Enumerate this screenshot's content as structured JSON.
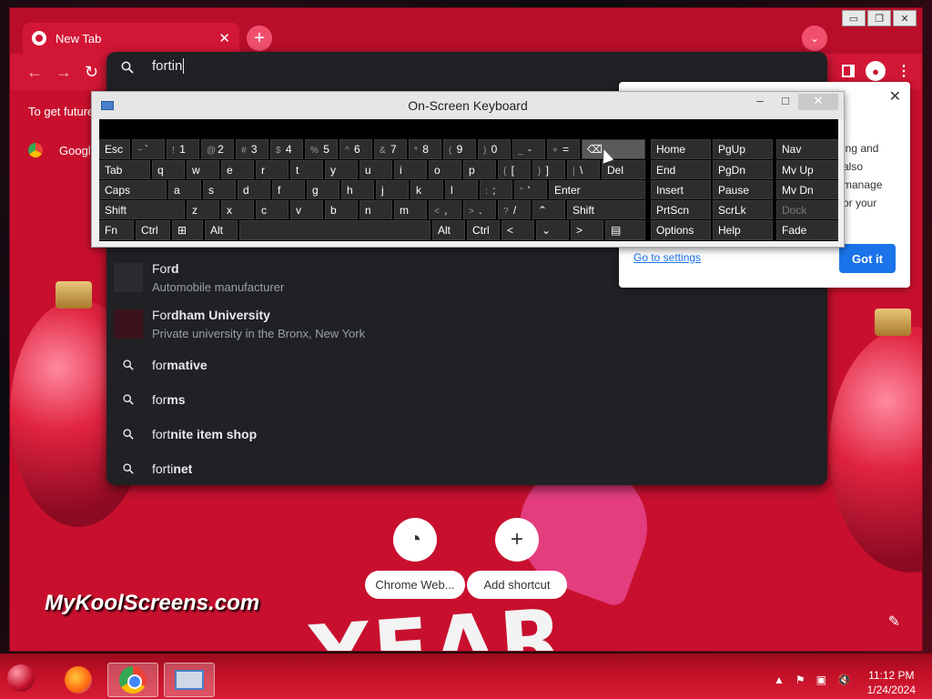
{
  "browser": {
    "tab_title": "New Tab",
    "tab_close": "✕",
    "new_tab": "+",
    "tab_search": "⌄",
    "window_controls": [
      "▭",
      "❐",
      "✕"
    ],
    "nav": {
      "back": "←",
      "forward": "→",
      "reload": "↻"
    },
    "info_bar": "To get future",
    "bookmark_label": "Googl"
  },
  "omnibox": {
    "query": "fortin",
    "suggestions": [
      {
        "title_prefix": "For",
        "title_bold": "d",
        "subtitle": "Automobile manufacturer",
        "type": "entity"
      },
      {
        "title_prefix": "For",
        "title_bold": "dham University",
        "subtitle": "Private university in the Bronx, New York",
        "type": "entity"
      },
      {
        "title_prefix": "for",
        "title_bold": "mative",
        "type": "search"
      },
      {
        "title_prefix": "for",
        "title_bold": "ms",
        "type": "search"
      },
      {
        "title_prefix": "fort",
        "title_bold": "nite item shop",
        "type": "search"
      },
      {
        "title_prefix": "forti",
        "title_bold": "net",
        "type": "search"
      }
    ]
  },
  "bubble": {
    "lines": [
      "ing and",
      "also",
      "manage",
      "or your"
    ],
    "link": "Go to settings",
    "button": "Got it",
    "close": "✕"
  },
  "osk": {
    "title": "On-Screen Keyboard",
    "minimize": "–",
    "maximize": "□",
    "close": "✕"
  },
  "ntp": {
    "shortcuts": [
      {
        "label": "Chrome Web..."
      },
      {
        "label": "Add shortcut",
        "icon": "+"
      }
    ],
    "watermark": "MyKoolScreens.com",
    "year_text": "YEAR",
    "pencil": "✎"
  },
  "taskbar": {
    "time": "11:12 PM",
    "date": "1/24/2024",
    "tray_icons": [
      "▲",
      "⚑",
      "▣",
      "🔇"
    ]
  }
}
